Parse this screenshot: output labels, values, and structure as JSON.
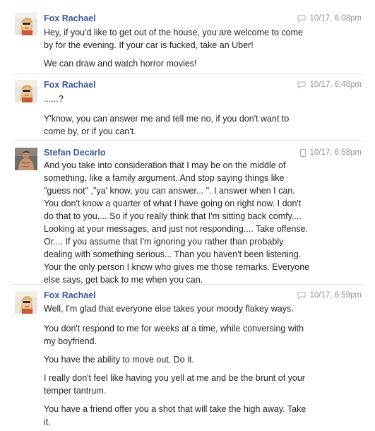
{
  "messages": [
    {
      "sender": "Fox Rachael",
      "time": "10/17, 6:08pm",
      "avatar": "avatar-fox-rachael",
      "device_icon": "chat-bubble-icon",
      "paragraphs": [
        "Hey, if you'd like to get out of the house, you are welcome to come\nby for the evening. If your car is fucked, take an Uber!",
        "We can draw and watch horror movies!"
      ]
    },
    {
      "sender": "Fox Rachael",
      "time": "10/17, 6:48pm",
      "avatar": "avatar-fox-rachael",
      "device_icon": "chat-bubble-icon",
      "paragraphs": [
        "......?",
        "Y'know, you can answer me and tell me no, if you don't want to\ncome by, or if you can't."
      ]
    },
    {
      "sender": "Stefan Decarlo",
      "time": "10/17, 6:58pm",
      "avatar": "avatar-stefan-decarlo",
      "device_icon": "phone-icon",
      "paragraphs": [
        "And you take into consideration that I may be on the middle of\nsomething, like a family argument. And stop saying things like\n\"guess not\" ,\"ya' know, you can answer... \".   I answer when I can.\nYou don't know a quarter of what I have going on right now. I don't\ndo that to you.... So if you really think that I'm sitting back comfy....\nLooking at your messages, and just not responding.... Take offense.\nOr.... If you assume that I'm ignoring you rather than probably\ndealing with something serious... Than you haven't been listening.\nYour the only person I know who gives me those remarks. Everyone\nelse says, get back to me when you can."
      ]
    },
    {
      "sender": "Fox Rachael",
      "time": "10/17, 6:59pm",
      "avatar": "avatar-fox-rachael",
      "device_icon": "chat-bubble-icon",
      "paragraphs": [
        "Well, I'm glad that everyone else takes your moody flakey ways.",
        "You don't respond to me for weeks at a time, while conversing with\nmy boyfriend.",
        "You have the ability to move out. Do it.",
        "I really don't feel like having you yell at me and be the brunt of your\ntemper tantrum.",
        "You have a friend offer you a shot that will take the high away. Take\nit."
      ]
    }
  ]
}
